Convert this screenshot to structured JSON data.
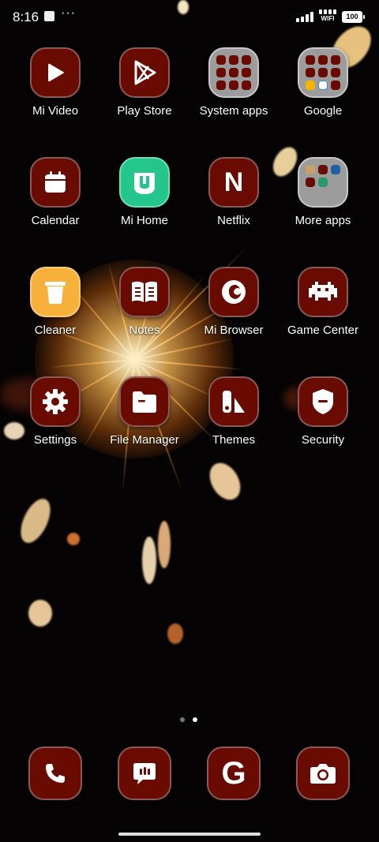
{
  "status_bar": {
    "time": "8:16",
    "wifi_label": "WIFI",
    "battery": "100"
  },
  "apps": [
    {
      "label": "Mi Video",
      "icon": "play-icon"
    },
    {
      "label": "Play Store",
      "icon": "play-store-icon"
    },
    {
      "label": "System apps",
      "icon": "folder-icon"
    },
    {
      "label": "Google",
      "icon": "folder-icon"
    },
    {
      "label": "Calendar",
      "icon": "calendar-icon"
    },
    {
      "label": "Mi Home",
      "icon": "mi-home-icon"
    },
    {
      "label": "Netflix",
      "icon": "netflix-icon"
    },
    {
      "label": "More apps",
      "icon": "folder-icon"
    },
    {
      "label": "Cleaner",
      "icon": "trash-icon"
    },
    {
      "label": "Notes",
      "icon": "notes-icon"
    },
    {
      "label": "Mi Browser",
      "icon": "browser-icon"
    },
    {
      "label": "Game Center",
      "icon": "game-icon"
    },
    {
      "label": "Settings",
      "icon": "gear-icon"
    },
    {
      "label": "File Manager",
      "icon": "folder-file-icon"
    },
    {
      "label": "Themes",
      "icon": "themes-icon"
    },
    {
      "label": "Security",
      "icon": "shield-icon"
    }
  ],
  "netflix_letter": "N",
  "dock": [
    {
      "icon": "phone-icon"
    },
    {
      "icon": "messages-icon"
    },
    {
      "icon": "google-icon",
      "letter": "G"
    },
    {
      "icon": "camera-icon"
    }
  ],
  "pages": {
    "count": 2,
    "active": 2
  },
  "colors": {
    "icon_bg": "#6a0b02",
    "cleaner_bg": "#f7b13a",
    "mihome_bg": "#25c58e",
    "folder_bg": "#9c9c9c"
  }
}
